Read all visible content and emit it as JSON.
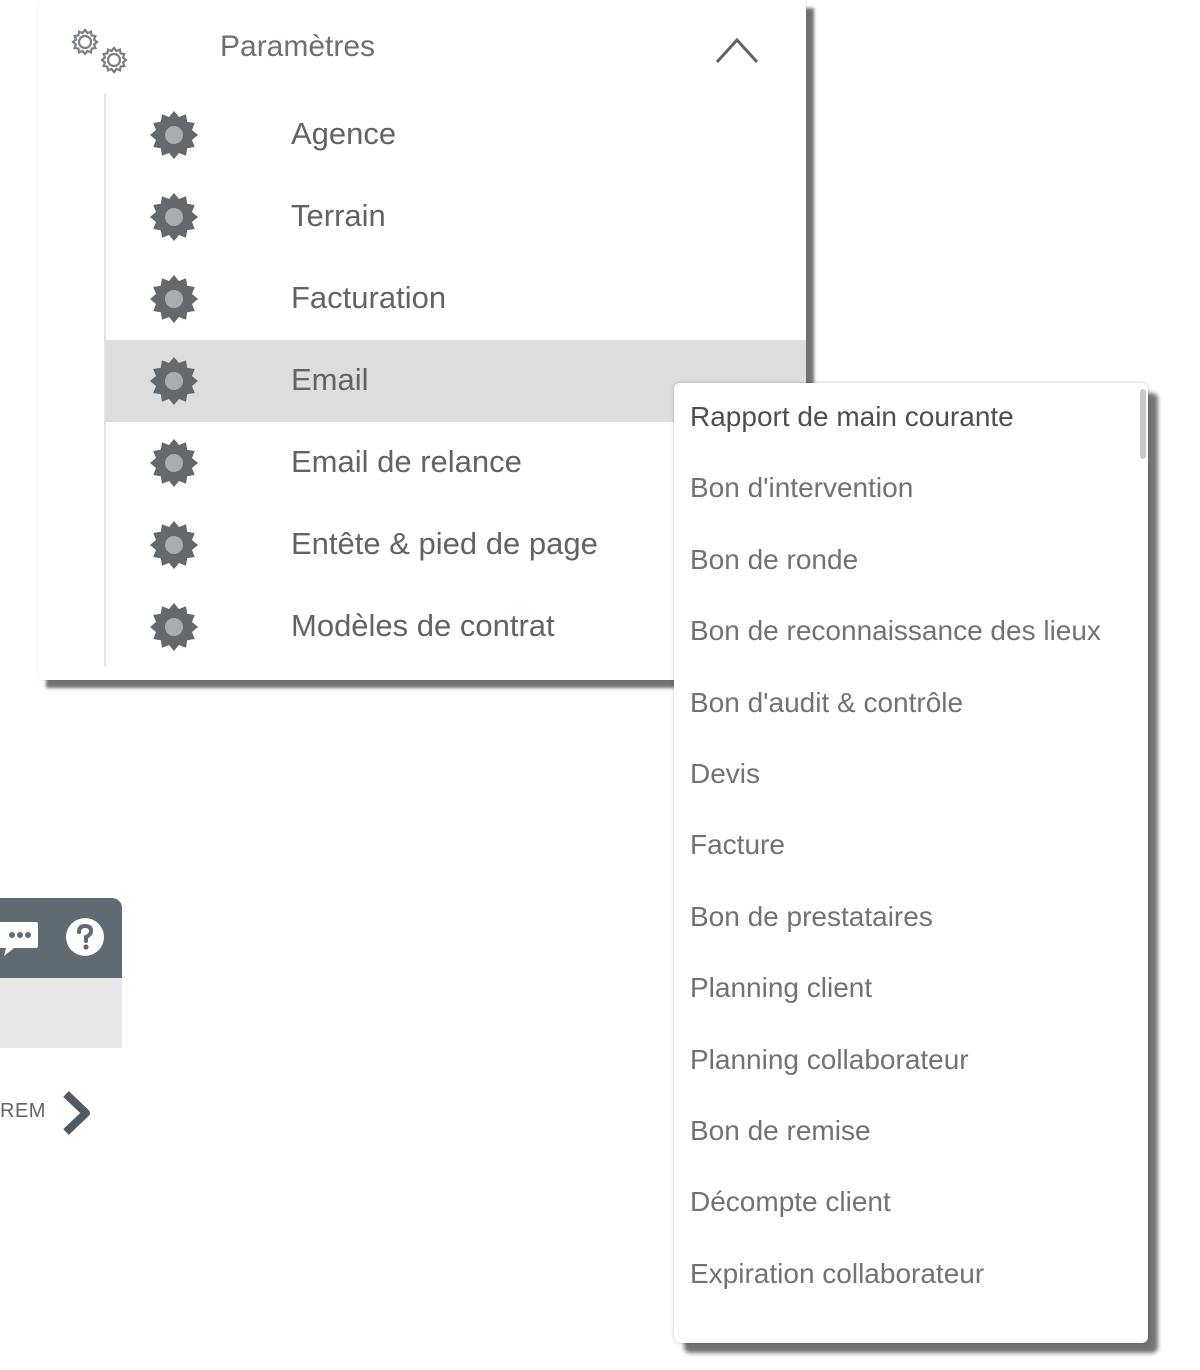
{
  "settings_menu": {
    "title": "Paramètres",
    "header_icon": "gears-icon",
    "collapse_icon": "chevron-up-icon",
    "items": [
      {
        "label": "Agence",
        "icon": "gear-icon"
      },
      {
        "label": "Terrain",
        "icon": "gear-icon"
      },
      {
        "label": "Facturation",
        "icon": "gear-icon"
      },
      {
        "label": "Email",
        "icon": "gear-icon",
        "active": true
      },
      {
        "label": "Email de relance",
        "icon": "gear-icon"
      },
      {
        "label": "Entête & pied de page",
        "icon": "gear-icon"
      },
      {
        "label": "Modèles de contrat",
        "icon": "gear-icon"
      }
    ]
  },
  "toolbar": {
    "icons": [
      "chat-icon",
      "help-icon"
    ]
  },
  "breadcrumb": {
    "text": "REM",
    "icon": "chevron-right-icon"
  },
  "email_dropdown": {
    "options": [
      "Rapport de main courante",
      "Bon d'intervention",
      "Bon de ronde",
      "Bon de reconnaissance des lieux",
      "Bon d'audit & contrôle",
      "Devis",
      "Facture",
      "Bon de prestataires",
      "Planning client",
      "Planning collaborateur",
      "Bon de remise",
      "Décompte client",
      "Expiration collaborateur"
    ]
  },
  "colors": {
    "active_row": "#dddddd",
    "toolbar": "#5f6a72",
    "icon_gray": "#6b7074",
    "text": "#5f6468"
  }
}
